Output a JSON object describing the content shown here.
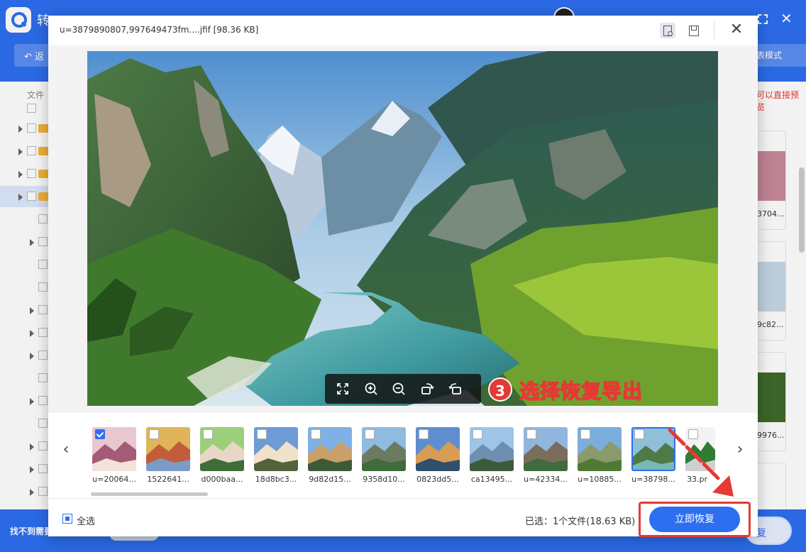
{
  "app": {
    "title": "转",
    "back_label": "返",
    "list_mode_label": "表模式",
    "tree_header": "文件",
    "hint_text": "可以直接预览",
    "not_found_text": "找不到需要",
    "recover_label": "复",
    "right_cards": [
      {
        "label": "3704..."
      },
      {
        "label": "9c82..."
      },
      {
        "label": "9976..."
      }
    ]
  },
  "dialog": {
    "title": "u=3879890807,997649473fm....jfif [98.36 KB]",
    "close_glyph": "✕"
  },
  "toolbar": {
    "tools": [
      {
        "name": "fullscreen-icon"
      },
      {
        "name": "zoom-in-icon"
      },
      {
        "name": "zoom-out-icon"
      },
      {
        "name": "rotate-right-icon"
      },
      {
        "name": "rotate-left-icon"
      }
    ]
  },
  "annotation": {
    "step_number": "3",
    "step_text": "选择恢复导出"
  },
  "strip": {
    "prev_glyph": "‹",
    "next_glyph": "›",
    "thumbnails": [
      {
        "label": "u=20064...",
        "checked": true,
        "active": false
      },
      {
        "label": "1522641...",
        "checked": false,
        "active": false
      },
      {
        "label": "d000baa...",
        "checked": false,
        "active": false
      },
      {
        "label": "18d8bc3...",
        "checked": false,
        "active": false
      },
      {
        "label": "9d82d15...",
        "checked": false,
        "active": false
      },
      {
        "label": "9358d10...",
        "checked": false,
        "active": false
      },
      {
        "label": "0823dd5...",
        "checked": false,
        "active": false
      },
      {
        "label": "ca13495...",
        "checked": false,
        "active": false
      },
      {
        "label": "u=42334...",
        "checked": false,
        "active": false
      },
      {
        "label": "u=10885...",
        "checked": false,
        "active": false
      },
      {
        "label": "u=38798...",
        "checked": false,
        "active": true
      },
      {
        "label": "33.pr",
        "checked": false,
        "active": false
      }
    ]
  },
  "footer": {
    "select_all_label": "全选",
    "selected_info": "已选：1个文件(18.63 KB)",
    "recover_button": "立即恢复"
  },
  "colors": {
    "brand": "#2d6ff0",
    "annotation_red": "#e53935"
  }
}
